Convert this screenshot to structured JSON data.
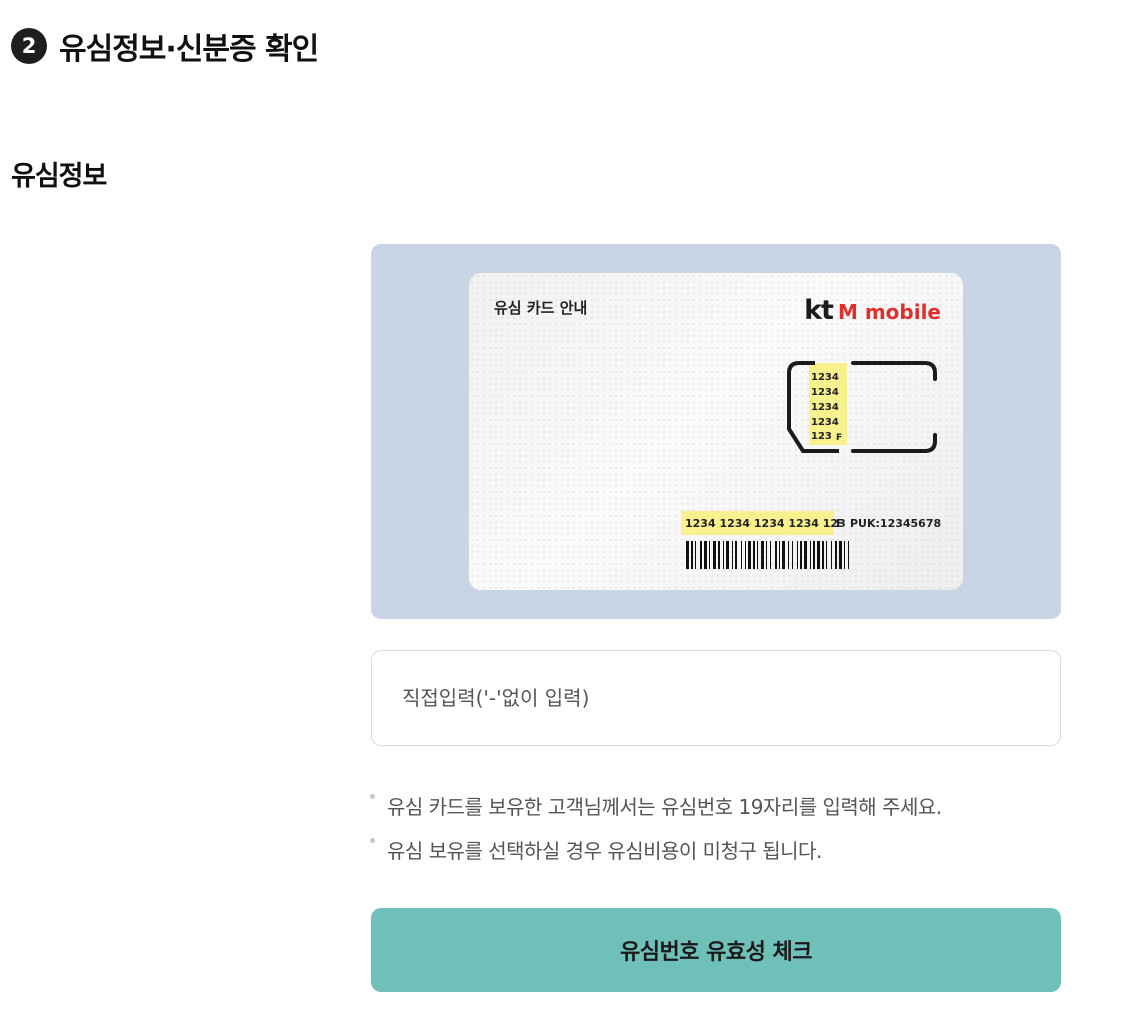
{
  "step": {
    "number": "2",
    "title": "유심정보·신분증 확인"
  },
  "section": {
    "title": "유심정보"
  },
  "sim_guide": {
    "title": "유심 카드 안내",
    "brand_kt": "kt",
    "brand_mobile": "M mobile",
    "brand_color": "#e0302e",
    "chip_numbers": [
      "1234",
      "1234",
      "1234",
      "1234",
      "123"
    ],
    "chip_suffix": "F",
    "serial": "1234 1234 1234 1234 123",
    "serial_suffix": "F",
    "puk": "PUK:12345678",
    "highlight_color": "#f7f18e"
  },
  "input": {
    "placeholder": "직접입력('-'없이 입력)",
    "value": ""
  },
  "notes": [
    "유심 카드를 보유한 고객님께서는 유심번호 19자리를 입력해 주세요.",
    "유심 보유를 선택하실 경우 유심비용이 미청구 됩니다."
  ],
  "button": {
    "label": "유심번호 유효성 체크",
    "color": "#70c0ba"
  }
}
